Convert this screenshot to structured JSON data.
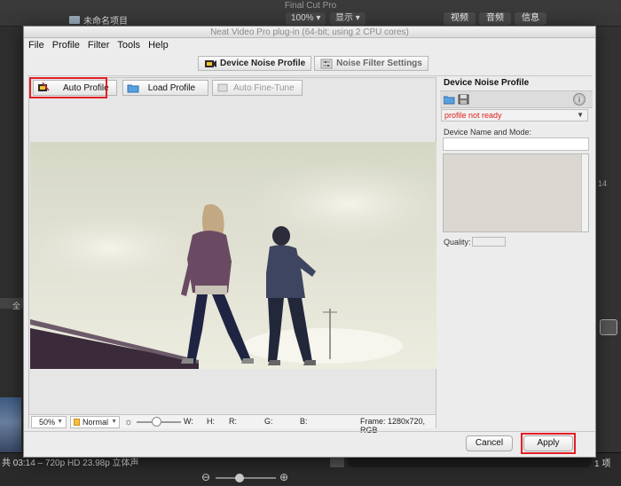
{
  "host": {
    "app_title": "Final Cut Pro",
    "project_name": "未命名项目",
    "zoom": "100%",
    "display_menu": "显示",
    "tabs": [
      "视频",
      "音频",
      "信息"
    ],
    "status_info": "共 03:14 – 720p HD 23.98p 立体声",
    "item_count": "1 项",
    "side_number": "14",
    "side_label": "全"
  },
  "dialog": {
    "title": "Neat Video Pro plug-in (64-bit; using 2 CPU cores)",
    "menu": [
      "File",
      "Profile",
      "Filter",
      "Tools",
      "Help"
    ],
    "mode_tabs": {
      "device_noise_profile": "Device Noise Profile",
      "noise_filter_settings": "Noise Filter Settings"
    },
    "toolbar": {
      "auto_profile": "Auto Profile",
      "load_profile": "Load Profile",
      "auto_fine_tune": "Auto Fine-Tune"
    },
    "status_bar": {
      "zoom": "50%",
      "view_mode": "Normal",
      "w": "W:",
      "h": "H:",
      "r": "R:",
      "g": "G:",
      "b": "B:",
      "frame": "Frame: 1280x720, RGB"
    },
    "right_panel": {
      "title": "Device Noise Profile",
      "profile_status": "profile not ready",
      "name_label": "Device Name and Mode:",
      "quality_label": "Quality:"
    },
    "buttons": {
      "cancel": "Cancel",
      "apply": "Apply"
    },
    "colors": {
      "highlight": "#e41e26",
      "status_error": "#e02020"
    }
  }
}
